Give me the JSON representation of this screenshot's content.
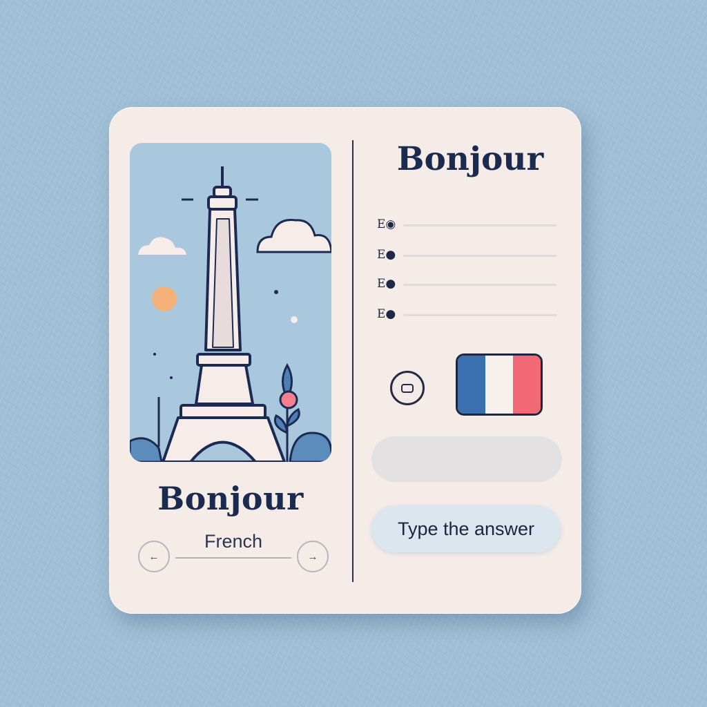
{
  "card": {
    "illustration": {
      "name": "eiffel-tower-illustration",
      "sky_color": "#a9c8de",
      "sun_color": "#f4b27a",
      "flower_color": "#f47f8e",
      "outline_color": "#1c2a52"
    },
    "left_word": "Bonjour",
    "language_label": "French",
    "prev_button_glyph": "←",
    "next_button_glyph": "→",
    "right_word": "Bonjour",
    "options": [
      {
        "marker": "E◉"
      },
      {
        "marker": "E●"
      },
      {
        "marker": "E●"
      },
      {
        "marker": "E●"
      }
    ],
    "audio_button_icon": "speaker-icon",
    "flag": {
      "name": "france-flag",
      "colors": [
        "#3a6fb0",
        "#f7f1ee",
        "#f26874"
      ]
    },
    "answer_input": {
      "value": "",
      "placeholder": ""
    },
    "answer_button_label": "Type the answer"
  },
  "theme": {
    "background": "#9fbfd6",
    "card_background": "#f5ece8",
    "text_color": "#1b2a4f"
  }
}
